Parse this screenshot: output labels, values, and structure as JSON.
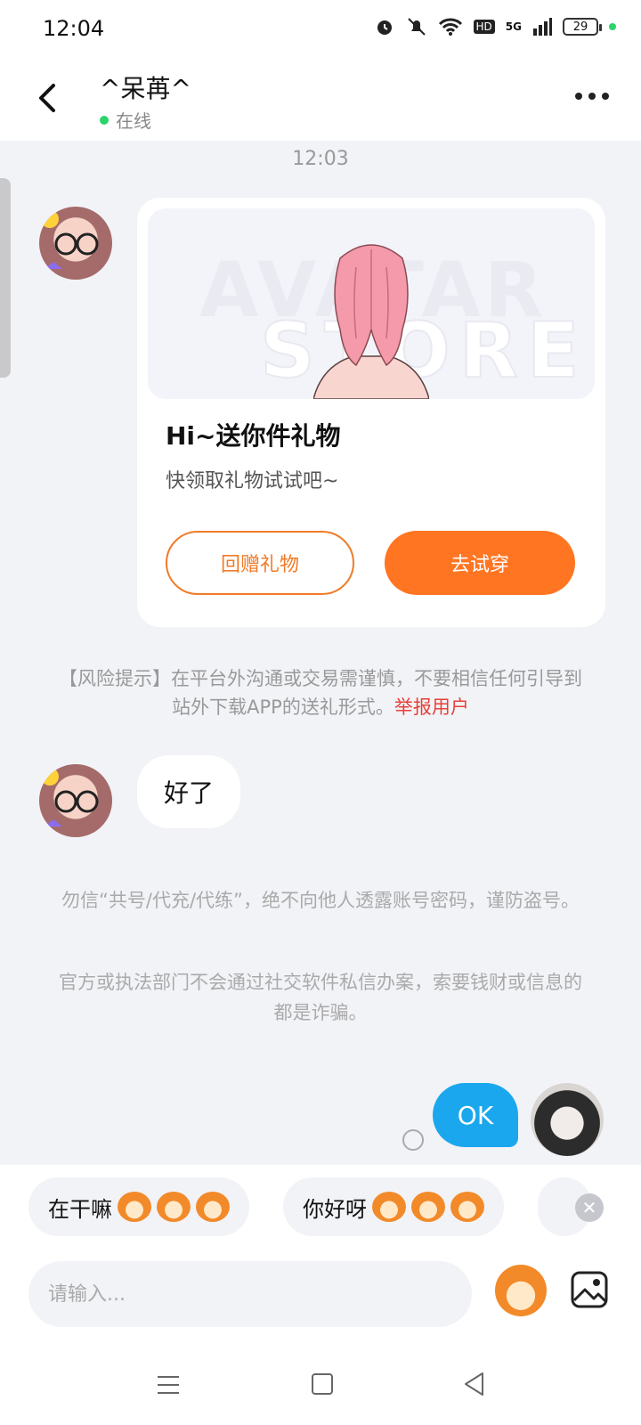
{
  "status_bar": {
    "time": "12:04",
    "network": "5G",
    "hd": "HD",
    "battery": "29"
  },
  "header": {
    "title": "^呆苒^",
    "status": "在线"
  },
  "chat": {
    "timestamp": "12:03",
    "gift_card": {
      "banner_watermark_1": "AVATAR",
      "banner_watermark_2": "STORE",
      "title": "Hi~送你件礼物",
      "subtitle": "快领取礼物试试吧~",
      "return_gift_button": "回赠礼物",
      "try_on_button": "去试穿"
    },
    "risk_notice": {
      "text": "【风险提示】在平台外沟通或交易需谨慎，不要相信任何引导到站外下载APP的送礼形式。",
      "report_link": "举报用户"
    },
    "received_message": "好了",
    "tip_1": "勿信“共号/代充/代练”，绝不向他人透露账号密码，谨防盗号。",
    "tip_2": "官方或执法部门不会通过社交软件私信办案，索要钱财或信息的都是诈骗。",
    "sent_message": "OK"
  },
  "quick_replies": [
    {
      "text": "在干嘛"
    },
    {
      "text": "你好呀"
    }
  ],
  "input": {
    "placeholder": "请输入..."
  },
  "icons": {
    "back": "chevron-left-icon",
    "more": "more-dots-icon",
    "emoji": "emoji-icon",
    "image": "image-icon",
    "close": "close-icon"
  },
  "colors": {
    "accent_orange": "#ff7522",
    "sent_bubble": "#1aa7ee",
    "online": "#2bd46b",
    "report_link": "#e8403a"
  }
}
